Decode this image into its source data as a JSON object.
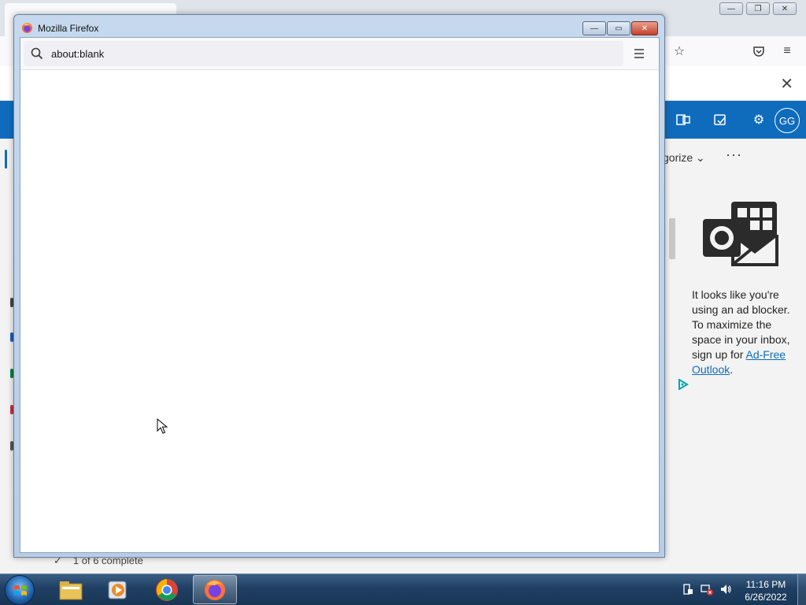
{
  "popup": {
    "title": "Mozilla Firefox",
    "url": "about:blank",
    "buttons": {
      "minimize": "—",
      "maximize": "▭",
      "close": "✕"
    }
  },
  "background": {
    "outlook": {
      "avatar_initials": "GG",
      "categorize_label": "gorize",
      "more_label": "···",
      "ad_text_pre": "It looks like you're using an ad blocker. To maximize the space in your inbox, sign up for ",
      "ad_link": "Ad-Free Outlook",
      "ad_text_post": ".",
      "progress_text": "1 of 6 complete",
      "colors": {
        "header": "#0f6cbd"
      }
    }
  },
  "taskbar": {
    "clock_time": "11:16 PM",
    "clock_date": "6/26/2022",
    "apps": [
      "file-explorer",
      "media-player",
      "chrome",
      "firefox"
    ]
  }
}
